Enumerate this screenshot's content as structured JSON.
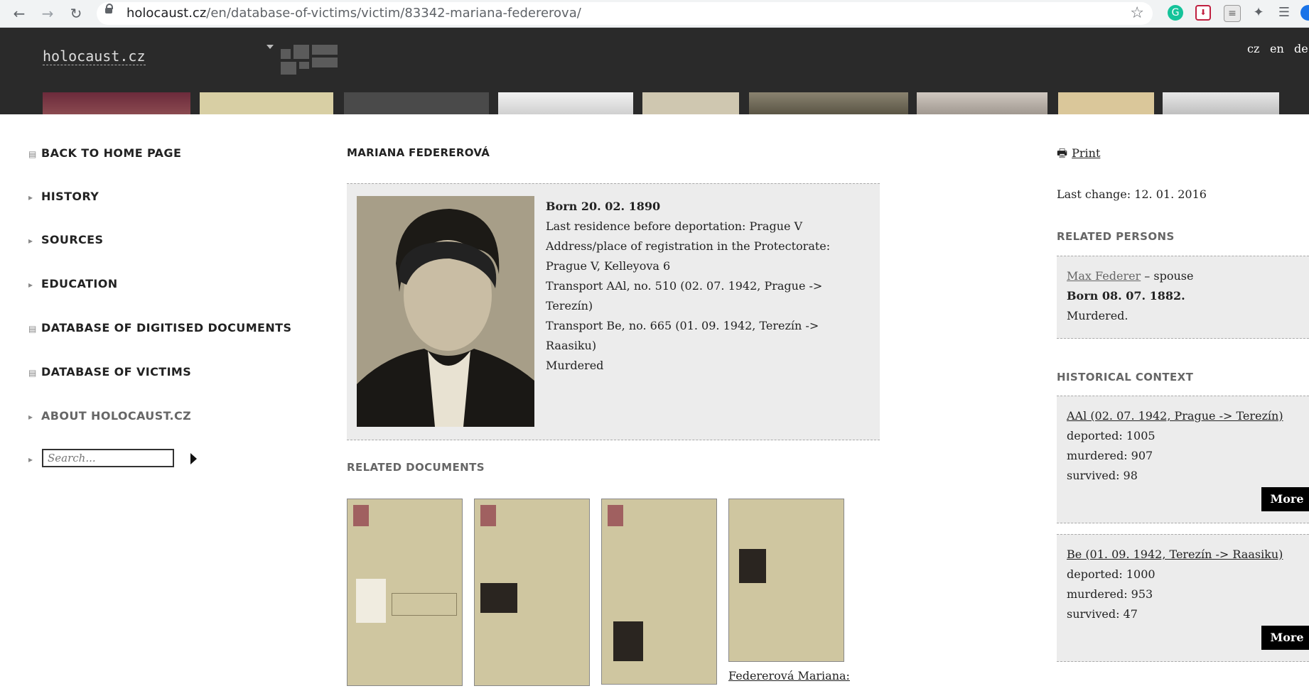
{
  "browser": {
    "url_domain": "holocaust.cz",
    "url_path": "/en/database-of-victims/victim/83342-mariana-federerova/"
  },
  "header": {
    "logo": "holocaust.cz",
    "languages": [
      "cz",
      "en",
      "de"
    ]
  },
  "sidebar": {
    "items": [
      {
        "label": "BACK TO HOME PAGE",
        "icon": "list-icon"
      },
      {
        "label": "HISTORY",
        "icon": "triangle-right-icon"
      },
      {
        "label": "SOURCES",
        "icon": "triangle-right-icon"
      },
      {
        "label": "EDUCATION",
        "icon": "triangle-right-icon"
      },
      {
        "label": "DATABASE OF DIGITISED DOCUMENTS",
        "icon": "list-icon"
      },
      {
        "label": "DATABASE OF VICTIMS",
        "icon": "list-icon"
      },
      {
        "label": "ABOUT HOLOCAUST.CZ",
        "icon": "triangle-right-icon"
      }
    ],
    "search_placeholder": "Search..."
  },
  "victim": {
    "name": "MARIANA FEDEREROVÁ",
    "born": "Born 20. 02. 1890",
    "last_residence": "Last residence before deportation: Prague V",
    "address": "Address/place of registration in the Protectorate: Prague V, Kelleyova 6",
    "transport1": "Transport AAl, no. 510 (02. 07. 1942, Prague -> Terezín)",
    "transport2": "Transport Be, no. 665 (01. 09. 1942, Terezín -> Raasiku)",
    "fate": "Murdered"
  },
  "related_documents": {
    "heading": "RELATED DOCUMENTS",
    "doc4_caption": "Federerová Mariana:"
  },
  "right": {
    "print_label": "Print",
    "last_change": "Last change: 12. 01. 2016",
    "related_persons_heading": "RELATED PERSONS",
    "person": {
      "name": "Max Federer",
      "relation": "– spouse",
      "born": "Born 08. 07. 1882.",
      "fate": "Murdered."
    },
    "historical_context_heading": "HISTORICAL CONTEXT",
    "transports": [
      {
        "title": "AAl (02. 07. 1942, Prague -> Terezín)",
        "deported": "deported: 1005",
        "murdered": "murdered: 907",
        "survived": "survived: 98",
        "more": "More"
      },
      {
        "title": "Be (01. 09. 1942, Terezín -> Raasiku)",
        "deported": "deported: 1000",
        "murdered": "murdered: 953",
        "survived": "survived: 47",
        "more": "More"
      }
    ]
  }
}
